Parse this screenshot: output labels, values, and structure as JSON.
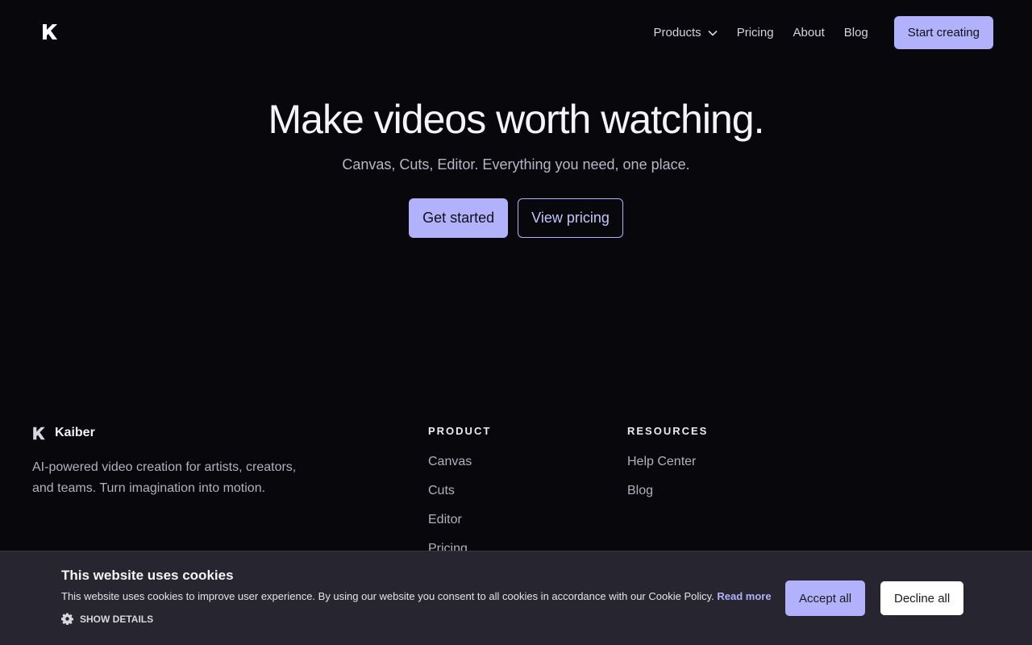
{
  "header": {
    "logo_icon": "kaiber-logo-icon",
    "nav": [
      {
        "label": "Products",
        "has_dropdown": true
      },
      {
        "label": "Pricing"
      },
      {
        "label": "About"
      },
      {
        "label": "Blog"
      }
    ],
    "cta_label": "Start creating"
  },
  "hero": {
    "title": "Make videos worth watching.",
    "subtitle": "Canvas, Cuts, Editor. Everything you need, one place.",
    "primary_button": "Get started",
    "secondary_button": "View pricing"
  },
  "footer": {
    "brand_name": "Kaiber",
    "brand_description": "AI-powered video creation for artists, creators, and teams. Turn imagination into motion.",
    "columns": [
      {
        "heading": "PRODUCT",
        "links": [
          "Canvas",
          "Cuts",
          "Editor",
          "Pricing"
        ]
      },
      {
        "heading": "RESOURCES",
        "links": [
          "Help Center",
          "Blog"
        ]
      }
    ]
  },
  "cookie_banner": {
    "title": "This website uses cookies",
    "text": "This website uses cookies to improve user experience. By using our website you consent to all cookies in accordance with our Cookie Policy.",
    "read_more": "Read more",
    "show_details": "SHOW DETAILS",
    "accept_label": "Accept all",
    "decline_label": "Decline all"
  },
  "colors": {
    "background": "#08070b",
    "accent": "#b1b2fb",
    "banner_background": "#27252f"
  }
}
